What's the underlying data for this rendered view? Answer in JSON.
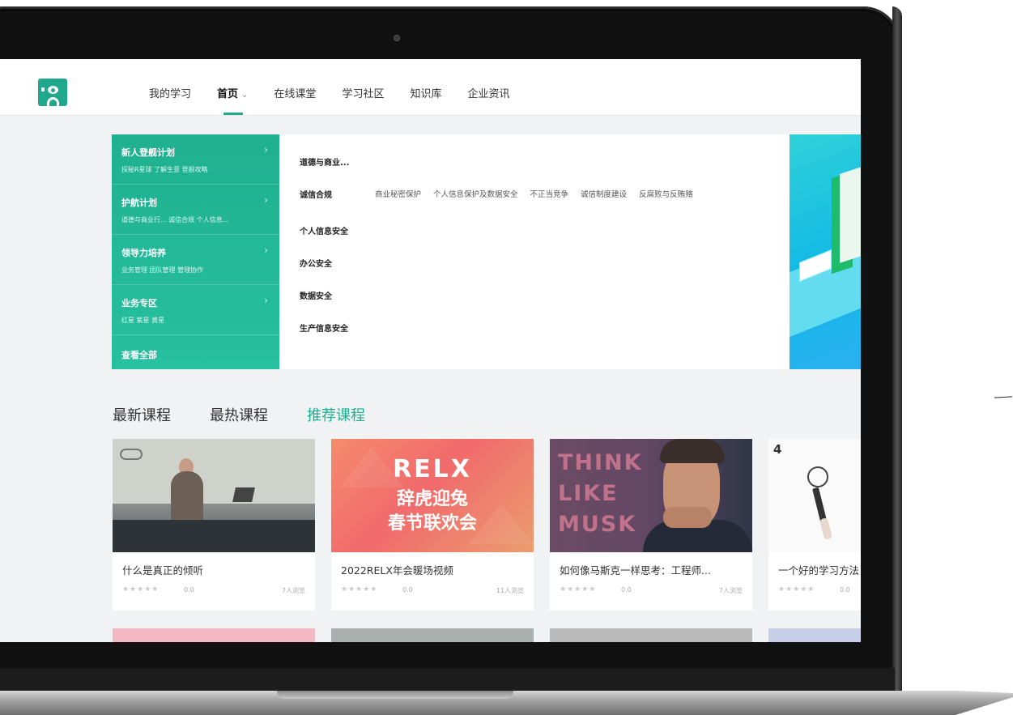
{
  "nav": {
    "items": [
      {
        "label": "我的学习"
      },
      {
        "label": "首页",
        "active": true
      },
      {
        "label": "在线课堂"
      },
      {
        "label": "学习社区"
      },
      {
        "label": "知识库"
      },
      {
        "label": "企业资讯"
      }
    ]
  },
  "categories": [
    {
      "title": "新人登舰计划",
      "sub": "探秘R星球  了解生意  登舰攻略"
    },
    {
      "title": "护航计划",
      "sub": "道德与商业行...  诚信合规  个人信息..."
    },
    {
      "title": "领导力培养",
      "sub": "业务管理  团队管理  管理协作"
    },
    {
      "title": "业务专区",
      "sub": "红星  紫星  黄星"
    },
    {
      "title": "查看全部",
      "sub": ""
    }
  ],
  "submenu": {
    "header": "道德与商业...",
    "rows": [
      {
        "label": "诚信合规",
        "tags": [
          "商业秘密保护",
          "个人信息保护及数据安全",
          "不正当竞争",
          "诚信制度建设",
          "反腐败与反贿赂"
        ]
      },
      {
        "label": "个人信息安全"
      },
      {
        "label": "办公安全"
      },
      {
        "label": "数据安全"
      },
      {
        "label": "生产信息安全"
      }
    ]
  },
  "course_tabs": [
    {
      "label": "最新课程"
    },
    {
      "label": "最热课程"
    },
    {
      "label": "推荐课程",
      "active": true
    }
  ],
  "courses": [
    {
      "title": "什么是真正的倾听",
      "score": "0.0",
      "viewers": "7人浏览"
    },
    {
      "title": "2022RELX年会暖场视频",
      "score": "0.0",
      "viewers": "11人浏览",
      "thumb_text": [
        "RELX",
        "辞虎迎兔",
        "春节联欢会"
      ]
    },
    {
      "title": "如何像马斯克一样思考：工程师...",
      "score": "0.0",
      "viewers": "7人浏览",
      "thumb_text": [
        "THINK",
        "LIKE",
        "MUSK"
      ]
    },
    {
      "title": "一个好的学习方法",
      "score": "0.0",
      "viewers": "",
      "thumb_text": [
        "4"
      ]
    }
  ],
  "stars": "★★★★★",
  "colors": {
    "accent": "#1fb08f"
  }
}
